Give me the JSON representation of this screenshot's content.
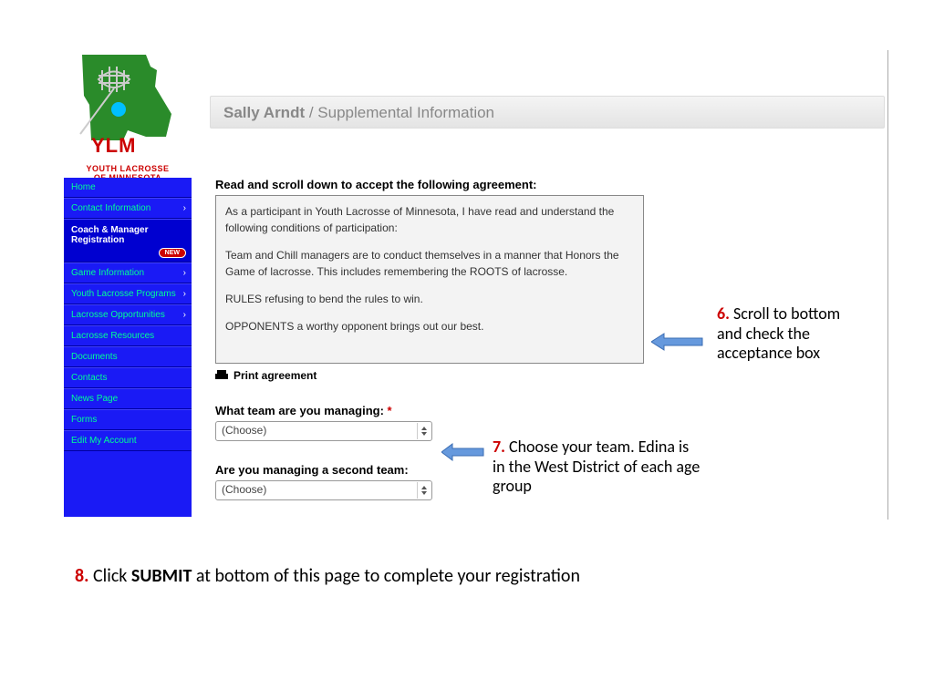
{
  "logo": {
    "abbrev": "YLM",
    "line1": "YOUTH LACROSSE",
    "line2": "OF MINNESOTA"
  },
  "header": {
    "user": "Sally Arndt",
    "sep": " / ",
    "section": "Supplemental Information"
  },
  "sidebar": {
    "items": [
      {
        "label": "Home",
        "expand": false
      },
      {
        "label": "Contact Information",
        "expand": true
      },
      {
        "label": "Coach & Manager Registration",
        "expand": false,
        "active": true,
        "badge": "NEW"
      },
      {
        "label": "Game Information",
        "expand": true
      },
      {
        "label": "Youth Lacrosse Programs",
        "expand": true
      },
      {
        "label": "Lacrosse Opportunities",
        "expand": true
      },
      {
        "label": "Lacrosse Resources",
        "expand": false
      },
      {
        "label": "Documents",
        "expand": false
      },
      {
        "label": "Contacts",
        "expand": false
      },
      {
        "label": "News Page",
        "expand": false
      },
      {
        "label": "Forms",
        "expand": false
      },
      {
        "label": "Edit My Account",
        "expand": false
      }
    ]
  },
  "agreement": {
    "heading": "Read and scroll down to accept the following agreement:",
    "p1": "As a participant in Youth Lacrosse of Minnesota, I have read and understand the following conditions of participation:",
    "p2": "Team and Chill managers are to conduct themselves in a manner that Honors the Game of lacrosse. This includes remembering the ROOTS of lacrosse.",
    "p3": "RULES refusing to bend the rules to win.",
    "p4": "OPPONENTS a worthy opponent brings out our best.",
    "print": "Print agreement"
  },
  "fields": {
    "team_label": "What team are you managing: ",
    "team_value": "(Choose)",
    "second_label": "Are you managing a second team:",
    "second_value": "(Choose)"
  },
  "annotations": {
    "six": {
      "num": "6.",
      "text": " Scroll to bottom and check the acceptance box"
    },
    "seven": {
      "num": "7.",
      "text": " Choose your team. Edina is in the West District of each age group"
    },
    "eight": {
      "num": "8.",
      "pre": " Click ",
      "bold": "SUBMIT",
      "post": " at bottom of this page to complete your registration"
    }
  }
}
